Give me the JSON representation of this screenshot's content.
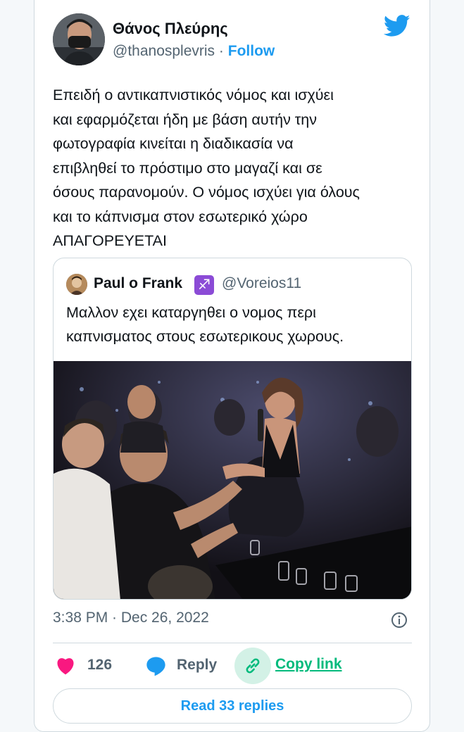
{
  "author": {
    "name": "Θάνος Πλεύρης",
    "handle": "@thanosplevris",
    "separator": "·",
    "follow_label": "Follow"
  },
  "tweet": {
    "lines": [
      "Επειδή ο αντικαπνιστικός νόμος και ισχύει",
      "και εφαρμόζεται ήδη με βάση αυτήν την",
      "φωτογραφία κινείται η διαδικασία να",
      "επιβληθεί το πρόστιμο στο μαγαζί και σε",
      "όσους παρανομούν. Ο νόμος ισχύει για όλους",
      "και το κάπνισμα στον εσωτερικό χώρο",
      "ΑΠΑΓΟΡΕΥΕΤΑΙ"
    ]
  },
  "quoted_tweet": {
    "name": "Paul o Frank",
    "badge": "♐",
    "handle": "@Voreios11",
    "lines": [
      "Μαλλον εχει καταργηθει ο νομος περι",
      "καπνισματος στους εσωτερικους χωρους."
    ]
  },
  "meta": {
    "timestamp": "3:38 PM · Dec 26, 2022"
  },
  "actions": {
    "like_count": "126",
    "reply_label": "Reply",
    "copy_link_label": "Copy link",
    "read_replies_label": "Read 33 replies"
  },
  "colors": {
    "brand_blue": "#1d9bf0",
    "like_pink": "#f91880",
    "copy_green": "#00ba7c",
    "muted_text": "#536471"
  },
  "icons": {
    "platform": "twitter-bird-icon",
    "info": "info-icon",
    "like": "heart-icon",
    "reply": "speech-bubble-icon",
    "copy": "link-icon"
  }
}
